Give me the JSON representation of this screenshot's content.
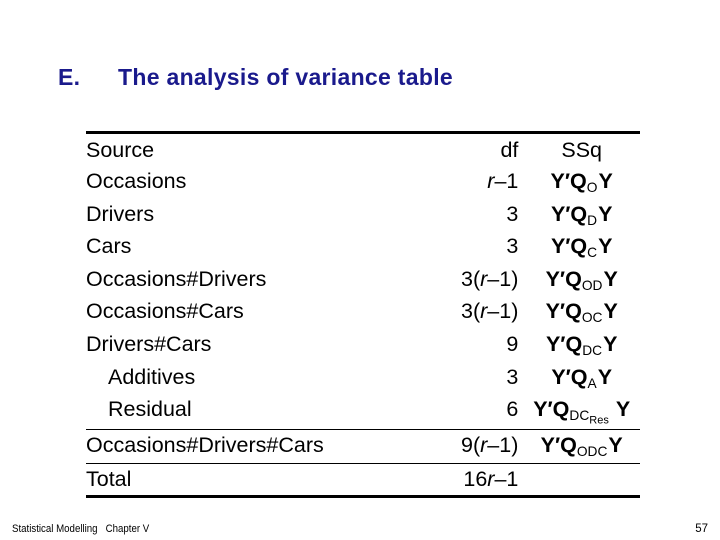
{
  "slide": {
    "section_letter": "E.",
    "title": "The analysis of variance table",
    "title_color": "#1a1a8c"
  },
  "table": {
    "headers": {
      "source": "Source",
      "df": "df",
      "ssq": "SSq"
    },
    "rows": [
      {
        "source": "Occasions",
        "df": "r–1",
        "ssq_sub": "O",
        "ssq_subsub": "",
        "indent": false
      },
      {
        "source": "Drivers",
        "df": "3",
        "ssq_sub": "D",
        "ssq_subsub": "",
        "indent": false
      },
      {
        "source": "Cars",
        "df": "3",
        "ssq_sub": "C",
        "ssq_subsub": "",
        "indent": false
      },
      {
        "source": "Occasions#Drivers",
        "df": "3(r–1)",
        "ssq_sub": "OD",
        "ssq_subsub": "",
        "indent": false
      },
      {
        "source": "Occasions#Cars",
        "df": "3(r–1)",
        "ssq_sub": "OC",
        "ssq_subsub": "",
        "indent": false
      },
      {
        "source": "Drivers#Cars",
        "df": "9",
        "ssq_sub": "DC",
        "ssq_subsub": "",
        "indent": false
      },
      {
        "source": "Additives",
        "df": "3",
        "ssq_sub": "A",
        "ssq_subsub": "",
        "indent": true
      },
      {
        "source": "Residual",
        "df": "6",
        "ssq_sub": "DC",
        "ssq_subsub": "Res",
        "indent": true
      },
      {
        "source": "Occasions#Drivers#Cars",
        "df": "9(r–1)",
        "ssq_sub": "ODC",
        "ssq_subsub": "",
        "indent": false
      },
      {
        "source": "Total",
        "df": "16r–1",
        "ssq_sub": "",
        "ssq_subsub": "",
        "indent": false
      }
    ],
    "ssq_prefix": "Y′Q",
    "ssq_suffix": "Y",
    "italic_var": "r"
  },
  "footer": {
    "left": "Statistical Modelling   Chapter V",
    "page": "57"
  }
}
